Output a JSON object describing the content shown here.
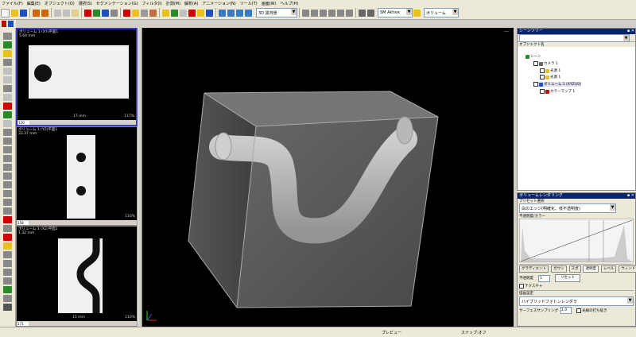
{
  "menu": [
    "ファイル(F)",
    "編集(E)",
    "オブジェクト(O)",
    "選択(S)",
    "セグメンテーション(G)",
    "フィルタ(I)",
    "計測(M)",
    "解析(A)",
    "アニメーション(N)",
    "ツール(T)",
    "画面(W)",
    "ヘルプ(H)"
  ],
  "toolbar": {
    "combo_render": "3D 黒背景",
    "combo_scheme": "SM Aktive",
    "combo_volume": "ボリューム",
    "colors": {
      "accent": "#0a246a",
      "red": "#cc0000",
      "yellow": "#e8c020",
      "green": "#2a8a2a",
      "blue": "#2050c0"
    }
  },
  "views": {
    "top": {
      "label1": "ボリューム 1 (XY)平面1",
      "label2": "5.64 mm",
      "scale": "17 mm",
      "zoom": "117%",
      "value": "120"
    },
    "mid": {
      "label1": "ボリューム 1 (YZ)平面1",
      "label2": "33.37 mm",
      "zoom": "110%",
      "value": "158"
    },
    "bot": {
      "label1": "ボリューム 1 (XZ)平面1",
      "label2": "1.32 mm",
      "scale": "15 mm",
      "zoom": "110%",
      "value": "171"
    },
    "main": {
      "corner": "—",
      "footer": "プレビュー"
    }
  },
  "scene_panel": {
    "title": "シーンツリー",
    "subtitle": "オブジェクト名",
    "items": [
      "シーン",
      "カメラ 1",
      "光源 1",
      "光源 1",
      "ボリューム 1 (XYZ)(0)",
      "カラーマップ 1"
    ]
  },
  "render_panel": {
    "title": "ボリュームレンダリング",
    "preset_label": "プリセット選択",
    "preset_value": "白のエッジ(明確化、低不透明度)",
    "curve_label": "不透明度/カラー",
    "tabs": [
      "グラディエント",
      "ガウシ",
      "スポ",
      "透明度",
      "レベル",
      "ウィンドウ"
    ],
    "opacity_label": "不透明度",
    "opacity_value": "1",
    "reset_btn": "リセット",
    "option1": "テクスチャ",
    "section2": "描画設定",
    "method_label": "ハイブリッドフォトンレンダラ",
    "sampling_label": "サーフェスサンプリング",
    "sampling_value": "1.0",
    "check_label": "光線の打ち抜き"
  },
  "status": {
    "right": "スナップ:オフ"
  }
}
